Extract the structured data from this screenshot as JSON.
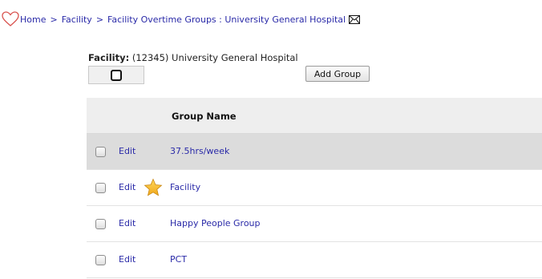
{
  "breadcrumb": {
    "items": [
      "Home",
      "Facility",
      "Facility Overtime Groups : University General Hospital"
    ],
    "separator": ">"
  },
  "facility": {
    "label": "Facility:",
    "value": "(12345) University General Hospital"
  },
  "buttons": {
    "add_group": "Add Group"
  },
  "table": {
    "header": {
      "group_name": "Group Name"
    },
    "edit_label": "Edit",
    "rows": [
      {
        "name": "37.5hrs/week",
        "starred": false,
        "highlighted": true
      },
      {
        "name": "Facility",
        "starred": true,
        "highlighted": false
      },
      {
        "name": "Happy People Group",
        "starred": false,
        "highlighted": false
      },
      {
        "name": "PCT",
        "starred": false,
        "highlighted": false
      }
    ]
  },
  "colors": {
    "link": "#2a2aa8",
    "heart": "#d9534f",
    "star": "#f0a81c",
    "header_bg": "#eeeeee",
    "highlight_row": "#dcdcdc"
  },
  "icons": [
    "heart-icon",
    "mail-icon",
    "star-icon"
  ]
}
